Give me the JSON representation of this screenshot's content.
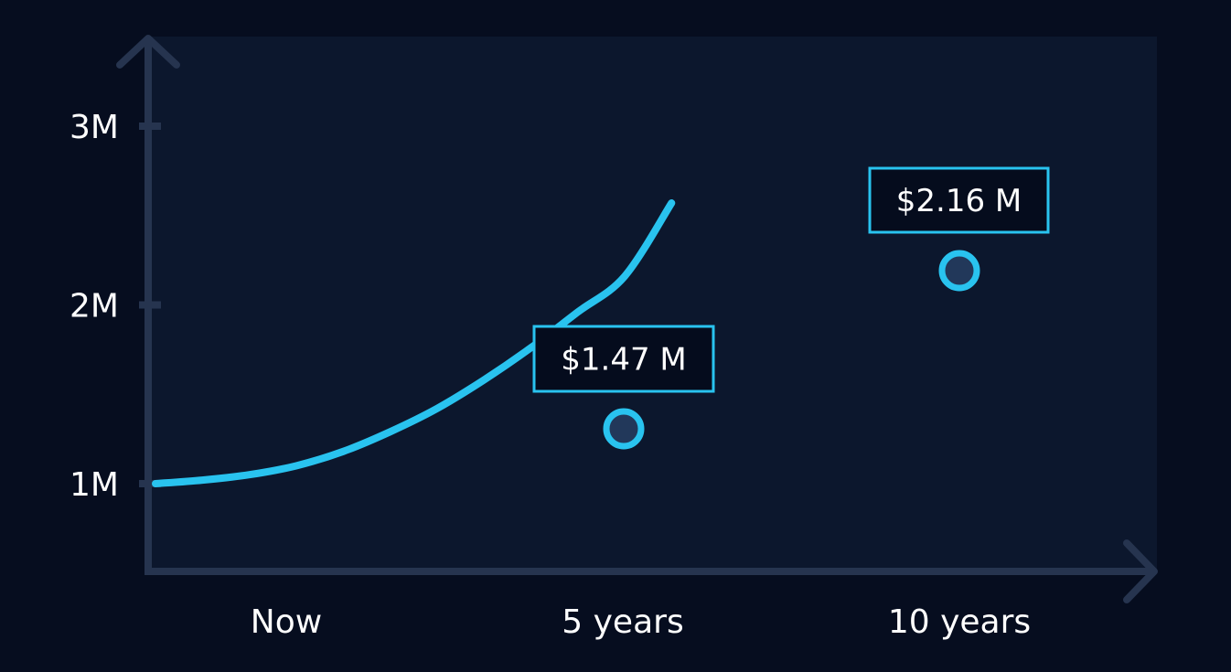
{
  "chart_data": {
    "type": "line",
    "title": "",
    "xlabel": "",
    "ylabel": "",
    "x_ticks": [
      "Now",
      "5 years",
      "10 years"
    ],
    "y_ticks": [
      "1M",
      "2M",
      "3M"
    ],
    "y_tick_values": [
      1000000,
      2000000,
      3000000
    ],
    "series": [
      {
        "x": [
          0,
          1,
          2,
          3,
          4,
          5,
          6,
          7,
          8,
          9,
          10,
          11
        ],
        "values": [
          1000000,
          1020000,
          1050000,
          1100000,
          1180000,
          1290000,
          1420000,
          1580000,
          1760000,
          1960000,
          2160000,
          2570000
        ]
      }
    ],
    "callouts": [
      {
        "x": 5,
        "value": 1470000,
        "label": "$1.47 M"
      },
      {
        "x": 10,
        "value": 2160000,
        "label": "$2.16 M"
      }
    ],
    "colors": {
      "page_background": "#060d1f",
      "plot_background": "#0c172d",
      "axis": "#26344f",
      "line": "#29c3ef",
      "marker_fill": "#22385a",
      "callout_fill": "#050c1d",
      "text": "#ffffff"
    },
    "grid": false,
    "legend": "none"
  }
}
